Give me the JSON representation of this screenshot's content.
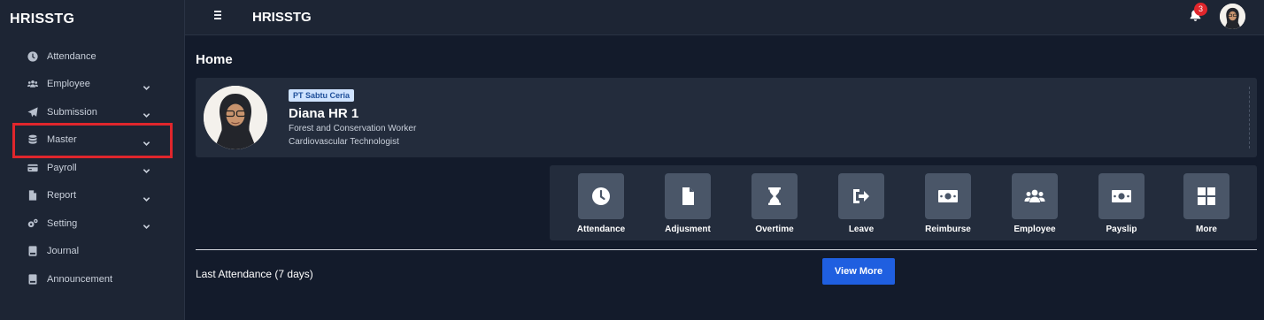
{
  "app": {
    "brand": "HRISSTG",
    "title": "HRISSTG"
  },
  "sidebar": {
    "items": [
      {
        "label": "Attendance",
        "icon": "clock-icon",
        "chevron": false
      },
      {
        "label": "Employee",
        "icon": "users-icon",
        "chevron": true
      },
      {
        "label": "Submission",
        "icon": "paper-plane-icon",
        "chevron": true
      },
      {
        "label": "Master",
        "icon": "database-icon",
        "chevron": true,
        "highlighted": true
      },
      {
        "label": "Payroll",
        "icon": "credit-card-icon",
        "chevron": true
      },
      {
        "label": "Report",
        "icon": "file-icon",
        "chevron": true
      },
      {
        "label": "Setting",
        "icon": "cogs-icon",
        "chevron": true
      },
      {
        "label": "Journal",
        "icon": "book-icon",
        "chevron": false
      },
      {
        "label": "Announcement",
        "icon": "book-icon",
        "chevron": false
      }
    ]
  },
  "topbar": {
    "notification_count": "3"
  },
  "main": {
    "page_title": "Home",
    "profile": {
      "company": "PT Sabtu Ceria",
      "name": "Diana HR 1",
      "position": "Forest and Conservation Worker",
      "job": "Cardiovascular Technologist"
    },
    "quick_actions": [
      {
        "label": "Attendance",
        "icon": "clock-icon"
      },
      {
        "label": "Adjusment",
        "icon": "file-icon"
      },
      {
        "label": "Overtime",
        "icon": "hourglass-icon"
      },
      {
        "label": "Leave",
        "icon": "sign-out-icon"
      },
      {
        "label": "Reimburse",
        "icon": "money-bill-icon"
      },
      {
        "label": "Employee",
        "icon": "users-icon"
      },
      {
        "label": "Payslip",
        "icon": "money-bill-icon"
      },
      {
        "label": "More",
        "icon": "grid-icon"
      }
    ],
    "last_attendance_label": "Last Attendance (7 days)",
    "view_more_label": "View More"
  },
  "colors": {
    "sidebar_bg": "#1d2534",
    "content_bg": "#131b2b",
    "card_bg": "#232c3c",
    "tile_bg": "#4a5668",
    "accent": "#1f5fe0",
    "highlight": "#e0262c"
  }
}
